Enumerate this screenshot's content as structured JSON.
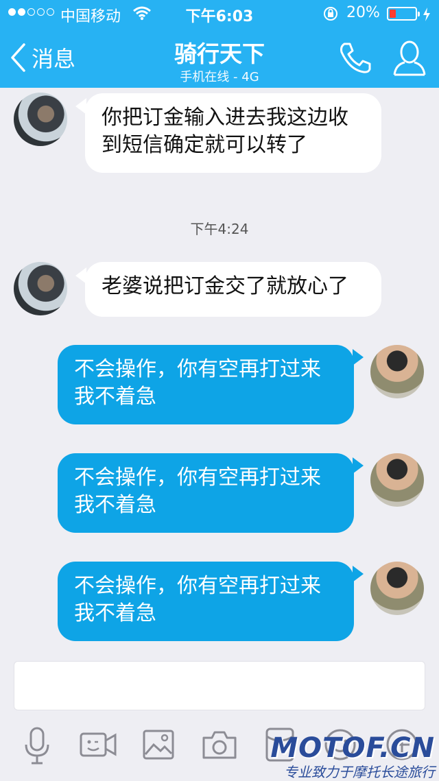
{
  "status_bar": {
    "carrier": "中国移动",
    "time": "下午6:03",
    "battery": "20%",
    "signal_dots": 2
  },
  "nav": {
    "back_label": "消息",
    "title": "骑行天下",
    "subtitle": "手机在线 - 4G"
  },
  "messages": [
    {
      "from": "them",
      "text": "你把订金输入进去我这边收到短信确定就可以转了"
    },
    {
      "from": "them",
      "text": "老婆说把订金交了就放心了"
    },
    {
      "from": "me",
      "text": "不会操作，你有空再打过来我不着急"
    },
    {
      "from": "me",
      "text": "不会操作，你有空再打过来我不着急"
    },
    {
      "from": "me",
      "text": "不会操作，你有空再打过来我不着急"
    }
  ],
  "timestamp": "下午4:24",
  "input": {
    "placeholder": ""
  },
  "toolbar": [
    "mic-icon",
    "video-icon",
    "image-icon",
    "camera-icon",
    "red-packet-icon",
    "emoji-icon",
    "plus-icon"
  ],
  "watermark": {
    "brand": "MOTOF.CN",
    "slogan": "专业致力于摩托长途旅行"
  },
  "colors": {
    "accent": "#27b2f3",
    "out_bubble": "#0ea4e6",
    "background": "#eeeef3"
  }
}
